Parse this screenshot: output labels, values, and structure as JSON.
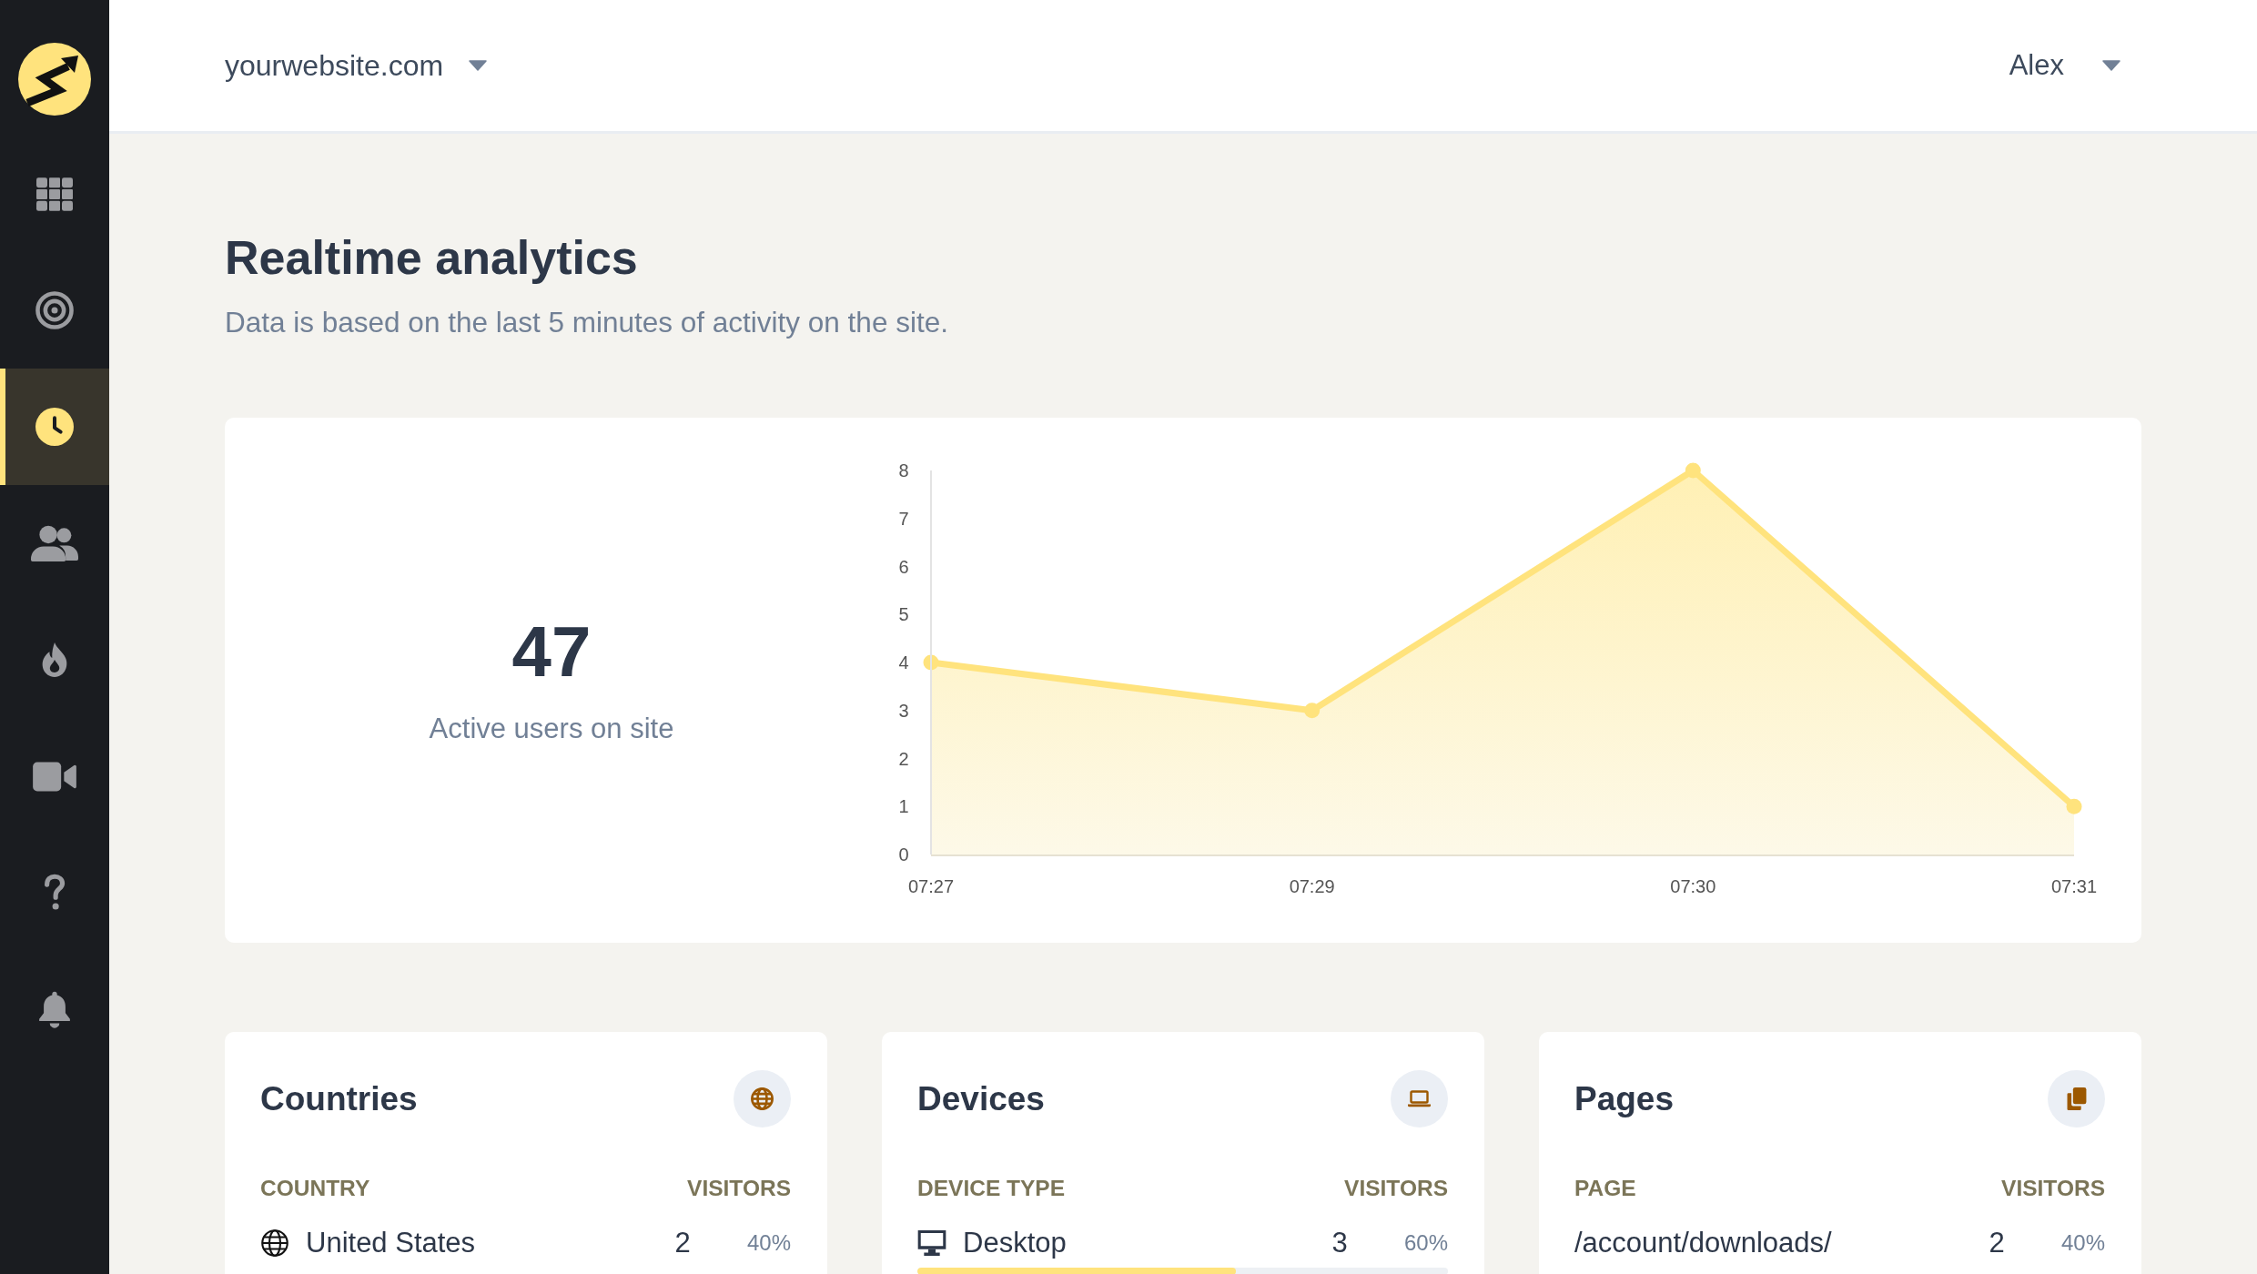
{
  "sidebar": {
    "items": [
      {
        "selected": false
      },
      {
        "selected": false
      },
      {
        "selected": true
      },
      {
        "selected": false
      },
      {
        "selected": false
      },
      {
        "selected": false
      },
      {
        "selected": false
      },
      {
        "selected": false
      }
    ]
  },
  "header": {
    "site_selector": "yourwebsite.com",
    "user_menu": "Alex"
  },
  "page": {
    "title": "Realtime analytics",
    "subtitle": "Data is based on the last 5 minutes of activity on the site."
  },
  "overview": {
    "active_users": "47",
    "active_users_label": "Active users on site",
    "chart_data": {
      "type": "area",
      "categories": [
        "07:27",
        "07:29",
        "07:30",
        "07:31"
      ],
      "series": [
        {
          "color": "#ffe37d",
          "values": [
            4,
            3,
            8,
            1
          ]
        }
      ],
      "ylim": [
        0,
        8
      ],
      "yticks": [
        0,
        1,
        2,
        3,
        4,
        5,
        6,
        7,
        8
      ]
    }
  },
  "panels": [
    {
      "title": "Countries",
      "columns": [
        "COUNTRY",
        "VISITORS"
      ],
      "rows": [
        {
          "label": "United States",
          "visitors": "2",
          "share": "40%"
        }
      ]
    },
    {
      "title": "Devices",
      "columns": [
        "DEVICE TYPE",
        "VISITORS"
      ],
      "rows": [
        {
          "label": "Desktop",
          "visitors": "3",
          "share": "60%",
          "level": 0.6
        }
      ]
    },
    {
      "title": "Pages",
      "columns": [
        "PAGE",
        "VISITORS"
      ],
      "rows": [
        {
          "label": "/account/downloads/",
          "visitors": "2",
          "share": "40%"
        }
      ]
    }
  ]
}
